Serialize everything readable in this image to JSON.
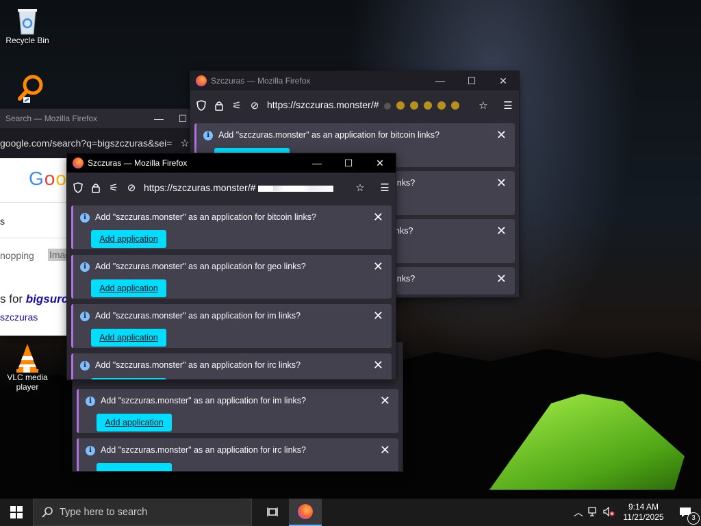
{
  "desktop": {
    "icons": [
      {
        "label": "Recycle Bin",
        "icon": "recycle-bin-icon"
      },
      {
        "label": "",
        "icon": "search-app-icon"
      },
      {
        "label": "VLC media player",
        "icon": "vlc-icon"
      }
    ]
  },
  "windows": {
    "back_google": {
      "title": "Search — Mozilla Firefox",
      "url": "google.com/search?q=bigszczuras&sei=k2",
      "logo": "Goo",
      "tab_fragment": "s",
      "shopping": "nopping",
      "images": "Imag",
      "results_for": "s for",
      "results_query": "bigsurc",
      "did_you_mean": "szczuras"
    },
    "right": {
      "title": "Szczuras — Mozilla Firefox",
      "url": "https://szczuras.monster/#",
      "notifications": [
        {
          "text": "Add \"szczuras.monster\" as an application for bitcoin links?"
        },
        {
          "text": "inks?"
        },
        {
          "text": "nks?"
        },
        {
          "text": "inks?"
        }
      ]
    },
    "front": {
      "title": "Szczuras — Mozilla Firefox",
      "url": "https://szczuras.monster/#",
      "button_label": "Add application",
      "notifications": [
        {
          "text": "Add \"szczuras.monster\" as an application for bitcoin links?"
        },
        {
          "text": "Add \"szczuras.monster\" as an application for geo links?"
        },
        {
          "text": "Add \"szczuras.monster\" as an application for im links?"
        },
        {
          "text": "Add \"szczuras.monster\" as an application for irc links?"
        }
      ]
    },
    "lower": {
      "notifications": [
        {
          "text": "Add \"szczuras.monster\" as an application for im links?"
        },
        {
          "text": "Add \"szczuras.monster\" as an application for irc links?"
        }
      ]
    }
  },
  "taskbar": {
    "search_placeholder": "Type here to search",
    "time": "9:14 AM",
    "date": "11/21/2025",
    "notification_count": "3"
  }
}
